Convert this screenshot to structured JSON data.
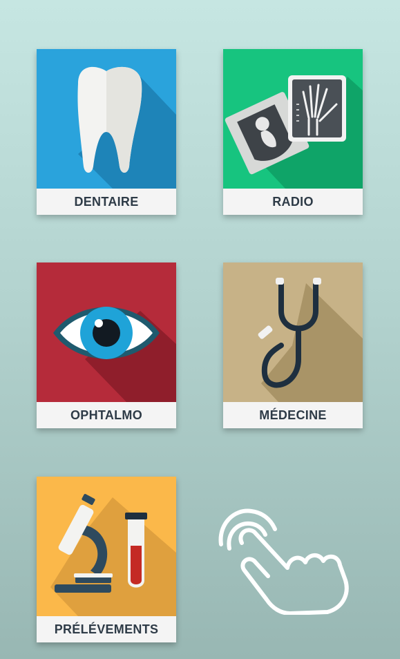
{
  "tiles": [
    {
      "id": "dentaire",
      "label": "DENTAIRE",
      "icon": "tooth-icon",
      "color": "#2aa3dc"
    },
    {
      "id": "radio",
      "label": "RADIO",
      "icon": "xray-icon",
      "color": "#17c47f"
    },
    {
      "id": "ophtalmo",
      "label": "OPHTALMO",
      "icon": "eye-icon",
      "color": "#b52b3a"
    },
    {
      "id": "medecine",
      "label": "MÉDECINE",
      "icon": "stethoscope-icon",
      "color": "#c7b287"
    },
    {
      "id": "prelevements",
      "label": "PRÉLÉVEMENTS",
      "icon": "microscope-icon",
      "color": "#fbb84a"
    }
  ],
  "hint": {
    "icon": "tap-hand-icon"
  }
}
